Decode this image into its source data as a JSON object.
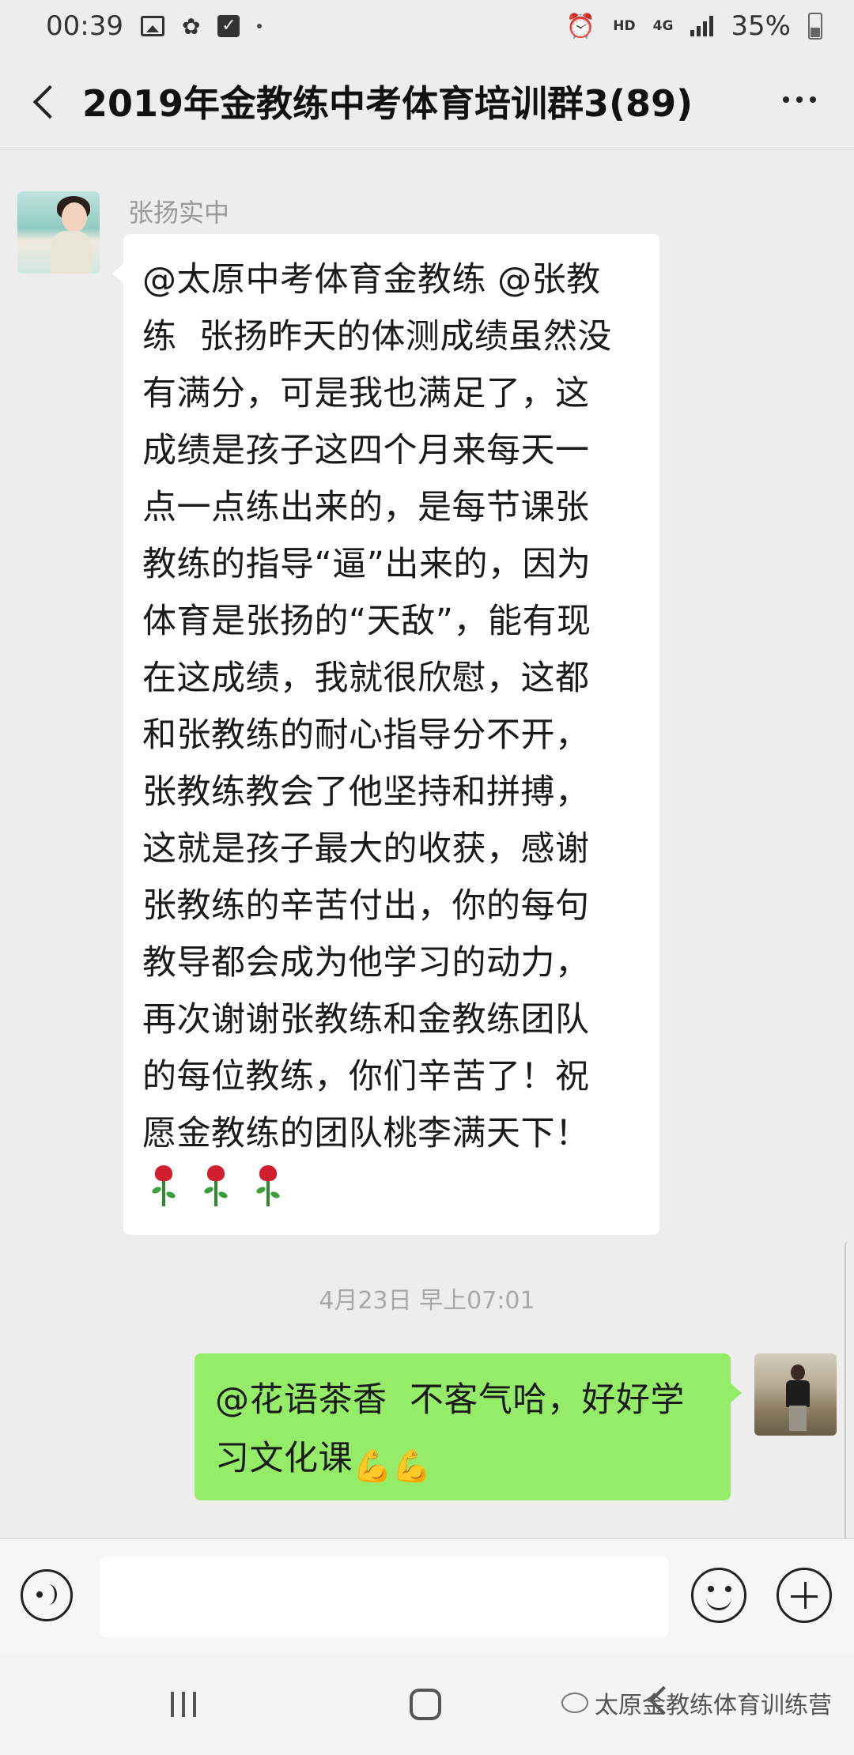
{
  "status_bar": {
    "time": "00:39",
    "hd": "HD",
    "network": "4G",
    "battery": "35%"
  },
  "header": {
    "title": "2019年金教练中考体育培训群3(89)"
  },
  "messages": [
    {
      "sender": "张扬实中",
      "text": "@太原中考体育金教练 @张教\n练  张扬昨天的体测成绩虽然没\n有满分，可是我也满足了，这\n成绩是孩子这四个月来每天一\n点一点练出来的，是每节课张\n教练的指导“逼”出来的，因为\n体育是张扬的“天敌”，能有现\n在这成绩，我就很欣慰，这都\n和张教练的耐心指导分不开，\n张教练教会了他坚持和拼搏，\n这就是孩子最大的收获，感谢\n张教练的辛苦付出，你的每句\n教导都会成为他学习的动力，\n再次谢谢张教练和金教练团队\n的每位教练，你们辛苦了！祝\n愿金教练的团队桃李满天下！"
    },
    {
      "timestamp": "4月23日 早上07:01"
    },
    {
      "text": "@花语茶香  不客气哈，好好学\n习文化课",
      "emoji": "💪💪"
    }
  ],
  "input": {
    "placeholder": ""
  },
  "watermark": "太原金教练体育训练营",
  "icons": {
    "voice": "voice-icon",
    "emoji": "emoji-icon",
    "plus": "plus-icon",
    "back": "back-icon",
    "more": "more-icon"
  }
}
